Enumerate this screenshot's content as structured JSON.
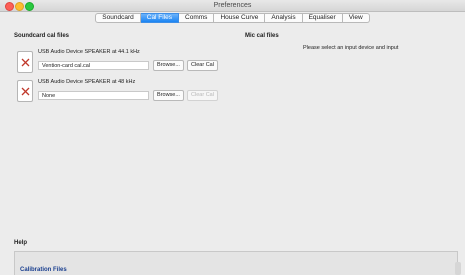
{
  "window": {
    "title": "Preferences"
  },
  "tabs": [
    {
      "label": "Soundcard"
    },
    {
      "label": "Cal Files"
    },
    {
      "label": "Comms"
    },
    {
      "label": "House Curve"
    },
    {
      "label": "Analysis"
    },
    {
      "label": "Equaliser"
    },
    {
      "label": "View"
    }
  ],
  "soundcard_cal": {
    "title": "Soundcard cal files",
    "rows": [
      {
        "device": "USB Audio Device SPEAKER at 44.1 kHz",
        "file": "Vention-card cal.cal",
        "browse_label": "Browse...",
        "clear_label": "Clear Cal",
        "clear_enabled": true
      },
      {
        "device": "USB Audio Device SPEAKER at 48 kHz",
        "file": "None",
        "browse_label": "Browse...",
        "clear_label": "Clear Cal",
        "clear_enabled": false
      }
    ]
  },
  "mic_cal": {
    "title": "Mic cal files",
    "message": "Please select an input device and input"
  },
  "help": {
    "title": "Help",
    "heading": "Calibration Files"
  },
  "colors": {
    "selected_tab": "#1b84f3",
    "clear_icon_red": "#c0392b",
    "help_heading": "#1a3f8f"
  },
  "icons": {
    "clear": "x-icon"
  }
}
